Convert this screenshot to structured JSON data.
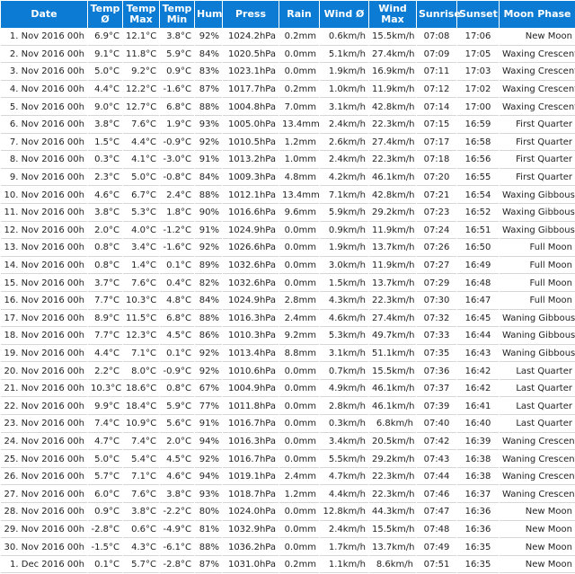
{
  "columns": [
    "Date",
    "Temp Ø",
    "Temp Max",
    "Temp Min",
    "Hum",
    "Press",
    "Rain",
    "Wind Ø",
    "Wind Max",
    "Sunrise",
    "Sunset",
    "Moon Phase"
  ],
  "rows": [
    [
      "1. Nov 2016 00h",
      "6.9°C",
      "12.1°C",
      "3.8°C",
      "92%",
      "1024.2hPa",
      "0.2mm",
      "0.6km/h",
      "15.5km/h",
      "07:08",
      "17:06",
      "New Moon"
    ],
    [
      "2. Nov 2016 00h",
      "9.1°C",
      "11.8°C",
      "5.9°C",
      "84%",
      "1020.5hPa",
      "0.0mm",
      "5.1km/h",
      "27.4km/h",
      "07:09",
      "17:05",
      "Waxing Crescent"
    ],
    [
      "3. Nov 2016 00h",
      "5.0°C",
      "9.2°C",
      "0.9°C",
      "83%",
      "1023.1hPa",
      "0.0mm",
      "1.9km/h",
      "16.9km/h",
      "07:11",
      "17:03",
      "Waxing Crescent"
    ],
    [
      "4. Nov 2016 00h",
      "4.4°C",
      "12.2°C",
      "-1.6°C",
      "87%",
      "1017.7hPa",
      "0.2mm",
      "1.0km/h",
      "11.9km/h",
      "07:12",
      "17:02",
      "Waxing Crescent"
    ],
    [
      "5. Nov 2016 00h",
      "9.0°C",
      "12.7°C",
      "6.8°C",
      "88%",
      "1004.8hPa",
      "7.0mm",
      "3.1km/h",
      "42.8km/h",
      "07:14",
      "17:00",
      "Waxing Crescent"
    ],
    [
      "6. Nov 2016 00h",
      "3.8°C",
      "7.6°C",
      "1.9°C",
      "93%",
      "1005.0hPa",
      "13.4mm",
      "2.4km/h",
      "22.3km/h",
      "07:15",
      "16:59",
      "First Quarter"
    ],
    [
      "7. Nov 2016 00h",
      "1.5°C",
      "4.4°C",
      "-0.9°C",
      "92%",
      "1010.5hPa",
      "1.2mm",
      "2.6km/h",
      "27.4km/h",
      "07:17",
      "16:58",
      "First Quarter"
    ],
    [
      "8. Nov 2016 00h",
      "0.3°C",
      "4.1°C",
      "-3.0°C",
      "91%",
      "1013.2hPa",
      "1.0mm",
      "2.4km/h",
      "22.3km/h",
      "07:18",
      "16:56",
      "First Quarter"
    ],
    [
      "9. Nov 2016 00h",
      "2.3°C",
      "5.0°C",
      "-0.8°C",
      "84%",
      "1009.3hPa",
      "4.8mm",
      "4.2km/h",
      "46.1km/h",
      "07:20",
      "16:55",
      "First Quarter"
    ],
    [
      "10. Nov 2016 00h",
      "4.6°C",
      "6.7°C",
      "2.4°C",
      "88%",
      "1012.1hPa",
      "13.4mm",
      "7.1km/h",
      "42.8km/h",
      "07:21",
      "16:54",
      "Waxing Gibbous"
    ],
    [
      "11. Nov 2016 00h",
      "3.8°C",
      "5.3°C",
      "1.8°C",
      "90%",
      "1016.6hPa",
      "9.6mm",
      "5.9km/h",
      "29.2km/h",
      "07:23",
      "16:52",
      "Waxing Gibbous"
    ],
    [
      "12. Nov 2016 00h",
      "2.0°C",
      "4.0°C",
      "-1.2°C",
      "91%",
      "1024.9hPa",
      "0.0mm",
      "0.9km/h",
      "11.9km/h",
      "07:24",
      "16:51",
      "Waxing Gibbous"
    ],
    [
      "13. Nov 2016 00h",
      "0.8°C",
      "3.4°C",
      "-1.6°C",
      "92%",
      "1026.6hPa",
      "0.0mm",
      "1.9km/h",
      "13.7km/h",
      "07:26",
      "16:50",
      "Full Moon"
    ],
    [
      "14. Nov 2016 00h",
      "0.8°C",
      "1.4°C",
      "0.1°C",
      "89%",
      "1032.6hPa",
      "0.0mm",
      "3.0km/h",
      "11.9km/h",
      "07:27",
      "16:49",
      "Full Moon"
    ],
    [
      "15. Nov 2016 00h",
      "3.7°C",
      "7.6°C",
      "0.4°C",
      "82%",
      "1032.6hPa",
      "0.0mm",
      "1.5km/h",
      "13.7km/h",
      "07:29",
      "16:48",
      "Full Moon"
    ],
    [
      "16. Nov 2016 00h",
      "7.7°C",
      "10.3°C",
      "4.8°C",
      "84%",
      "1024.9hPa",
      "2.8mm",
      "4.3km/h",
      "22.3km/h",
      "07:30",
      "16:47",
      "Full Moon"
    ],
    [
      "17. Nov 2016 00h",
      "8.9°C",
      "11.5°C",
      "6.8°C",
      "88%",
      "1016.3hPa",
      "2.4mm",
      "4.6km/h",
      "27.4km/h",
      "07:32",
      "16:45",
      "Waning Gibbous"
    ],
    [
      "18. Nov 2016 00h",
      "7.7°C",
      "12.3°C",
      "4.5°C",
      "86%",
      "1010.3hPa",
      "9.2mm",
      "5.3km/h",
      "49.7km/h",
      "07:33",
      "16:44",
      "Waning Gibbous"
    ],
    [
      "19. Nov 2016 00h",
      "4.4°C",
      "7.1°C",
      "0.1°C",
      "92%",
      "1013.4hPa",
      "8.8mm",
      "3.1km/h",
      "51.1km/h",
      "07:35",
      "16:43",
      "Waning Gibbous"
    ],
    [
      "20. Nov 2016 00h",
      "2.2°C",
      "8.0°C",
      "-0.9°C",
      "92%",
      "1010.6hPa",
      "0.0mm",
      "0.7km/h",
      "15.5km/h",
      "07:36",
      "16:42",
      "Last Quarter"
    ],
    [
      "21. Nov 2016 00h",
      "10.3°C",
      "18.6°C",
      "0.8°C",
      "67%",
      "1004.9hPa",
      "0.0mm",
      "4.9km/h",
      "46.1km/h",
      "07:37",
      "16:42",
      "Last Quarter"
    ],
    [
      "22. Nov 2016 00h",
      "9.9°C",
      "18.4°C",
      "5.9°C",
      "77%",
      "1011.8hPa",
      "0.0mm",
      "2.8km/h",
      "46.1km/h",
      "07:39",
      "16:41",
      "Last Quarter"
    ],
    [
      "23. Nov 2016 00h",
      "7.4°C",
      "10.9°C",
      "5.6°C",
      "91%",
      "1016.7hPa",
      "0.0mm",
      "0.3km/h",
      "6.8km/h",
      "07:40",
      "16:40",
      "Last Quarter"
    ],
    [
      "24. Nov 2016 00h",
      "4.7°C",
      "7.4°C",
      "2.0°C",
      "94%",
      "1016.3hPa",
      "0.0mm",
      "3.4km/h",
      "20.5km/h",
      "07:42",
      "16:39",
      "Waning Crescent"
    ],
    [
      "25. Nov 2016 00h",
      "5.0°C",
      "5.4°C",
      "4.5°C",
      "92%",
      "1016.7hPa",
      "0.0mm",
      "5.5km/h",
      "29.2km/h",
      "07:43",
      "16:38",
      "Waning Crescent"
    ],
    [
      "26. Nov 2016 00h",
      "5.7°C",
      "7.1°C",
      "4.6°C",
      "94%",
      "1019.1hPa",
      "2.4mm",
      "4.7km/h",
      "22.3km/h",
      "07:44",
      "16:38",
      "Waning Crescent"
    ],
    [
      "27. Nov 2016 00h",
      "6.0°C",
      "7.6°C",
      "3.8°C",
      "93%",
      "1018.7hPa",
      "1.2mm",
      "4.4km/h",
      "22.3km/h",
      "07:46",
      "16:37",
      "Waning Crescent"
    ],
    [
      "28. Nov 2016 00h",
      "0.9°C",
      "3.8°C",
      "-2.2°C",
      "80%",
      "1024.0hPa",
      "0.0mm",
      "12.8km/h",
      "44.3km/h",
      "07:47",
      "16:36",
      "New Moon"
    ],
    [
      "29. Nov 2016 00h",
      "-2.8°C",
      "0.6°C",
      "-4.9°C",
      "81%",
      "1032.9hPa",
      "0.0mm",
      "2.4km/h",
      "15.5km/h",
      "07:48",
      "16:36",
      "New Moon"
    ],
    [
      "30. Nov 2016 00h",
      "-1.5°C",
      "4.3°C",
      "-6.1°C",
      "88%",
      "1036.2hPa",
      "0.0mm",
      "1.7km/h",
      "13.7km/h",
      "07:49",
      "16:35",
      "New Moon"
    ],
    [
      "1. Dec 2016 00h",
      "0.1°C",
      "5.7°C",
      "-2.8°C",
      "87%",
      "1031.0hPa",
      "0.2mm",
      "1.1km/h",
      "8.6km/h",
      "07:51",
      "16:35",
      "New Moon"
    ]
  ]
}
